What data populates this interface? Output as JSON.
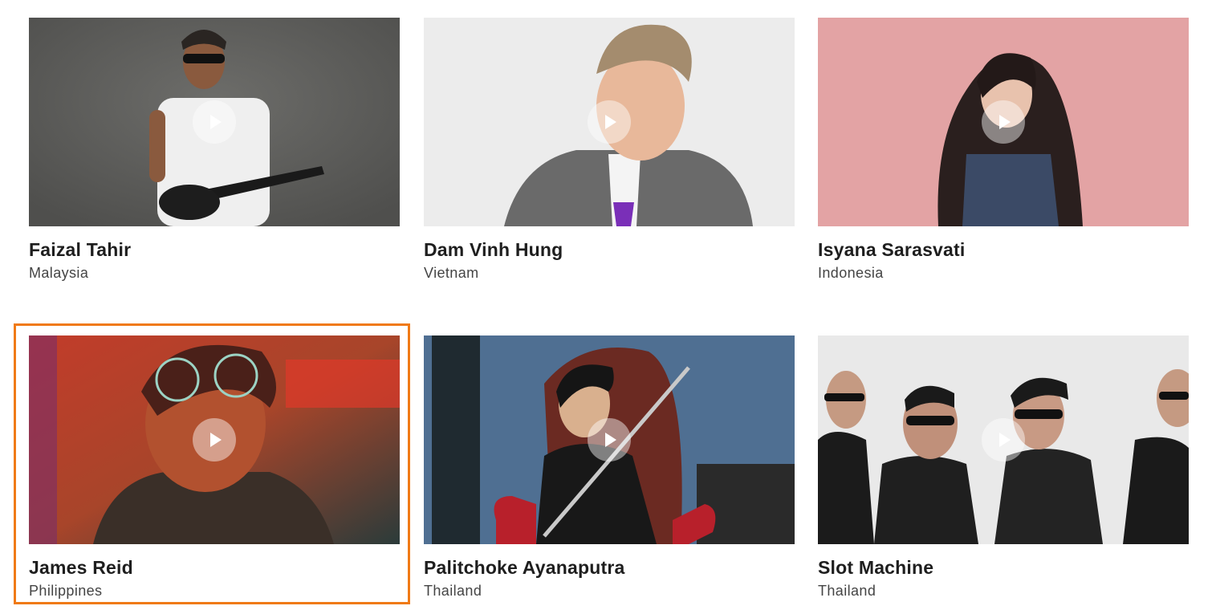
{
  "artists": [
    {
      "name": "Faizal Tahir",
      "country": "Malaysia"
    },
    {
      "name": "Dam Vinh Hung",
      "country": "Vietnam"
    },
    {
      "name": "Isyana Sarasvati",
      "country": "Indonesia"
    },
    {
      "name": "James Reid",
      "country": "Philippines"
    },
    {
      "name": "Palitchoke Ayanaputra",
      "country": "Thailand"
    },
    {
      "name": "Slot Machine",
      "country": "Thailand"
    }
  ],
  "icons": {
    "play": "play-icon"
  },
  "colors": {
    "focus_ring": "#f07a16",
    "name_text": "#1e1e1e",
    "country_text": "#444444"
  }
}
